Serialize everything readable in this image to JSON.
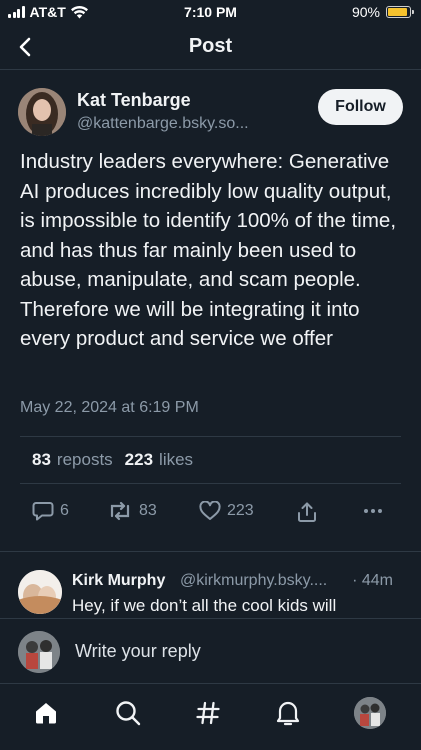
{
  "status_bar": {
    "carrier": "AT&T",
    "time": "7:10 PM",
    "battery_percent": "90%",
    "battery_level": 0.9,
    "battery_color": "#f7c32e"
  },
  "header": {
    "back_icon": "chevron-left-icon",
    "title": "Post"
  },
  "post": {
    "author_name": "Kat Tenbarge",
    "author_handle": "@kattenbarge.bsky.so...",
    "follow_label": "Follow",
    "text": "Industry leaders everywhere: Generative AI produces incredibly low quality output, is impossible to identify 100% of the time, and has thus far mainly been used to abuse, manipulate, and scam people. Therefore we will be integrating it into every product and service we offer",
    "date": "May 22, 2024 at 6:19 PM",
    "stats": {
      "reposts_count": "83",
      "reposts_label": "reposts",
      "likes_count": "223",
      "likes_label": "likes"
    },
    "actions": {
      "reply_count": "6",
      "repost_count": "83",
      "like_count": "223"
    }
  },
  "reply": {
    "author_name": "Kirk Murphy",
    "author_handle": "@kirkmurphy.bsky....",
    "time": "· 44m",
    "text": "Hey, if we don’t all the cool kids will"
  },
  "composer": {
    "placeholder": "Write your reply"
  },
  "tabbar": {
    "items": [
      "home-icon",
      "search-icon",
      "hashtag-icon",
      "notifications-icon",
      "profile-avatar"
    ]
  },
  "colors": {
    "background": "#161e27",
    "text": "#f1f3f5",
    "muted": "#8c9aa8",
    "divider": "#2e3944"
  }
}
